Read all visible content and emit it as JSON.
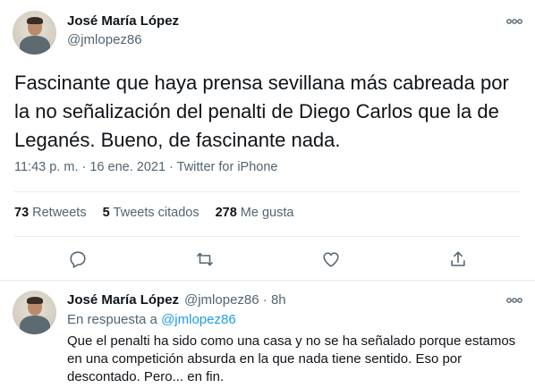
{
  "main_tweet": {
    "author_name": "José María López",
    "author_handle": "@jmlopez86",
    "text": "Fascinante que haya prensa sevillana más cabreada por la no señalización del penalti de Diego Carlos que la de Leganés. Bueno, de fascinante nada.",
    "time": "11:43 p. m.",
    "separator1": " · ",
    "date": "16 ene. 2021",
    "separator2": " · ",
    "source": "Twitter for iPhone",
    "stats": {
      "retweets_count": "73",
      "retweets_label": "Retweets",
      "quotes_count": "5",
      "quotes_label": "Tweets citados",
      "likes_count": "278",
      "likes_label": "Me gusta"
    },
    "action_icons": [
      "reply-icon",
      "retweet-icon",
      "like-icon",
      "share-icon"
    ]
  },
  "reply_tweet": {
    "author_name": "José María López",
    "author_handle": "@jmlopez86",
    "separator": " · ",
    "age": "8h",
    "reply_prefix": "En respuesta a ",
    "reply_mention": "@jmlopez86",
    "text": "Que el penalti ha sido como una casa y no se ha señalado porque estamos en una competición absurda en la que nada tiene sentido. Eso por descontado. Pero... en fin."
  },
  "colors": {
    "text_primary": "#0f1419",
    "text_secondary": "#536471",
    "accent": "#1d9bf0",
    "divider": "#e6ecf0"
  }
}
